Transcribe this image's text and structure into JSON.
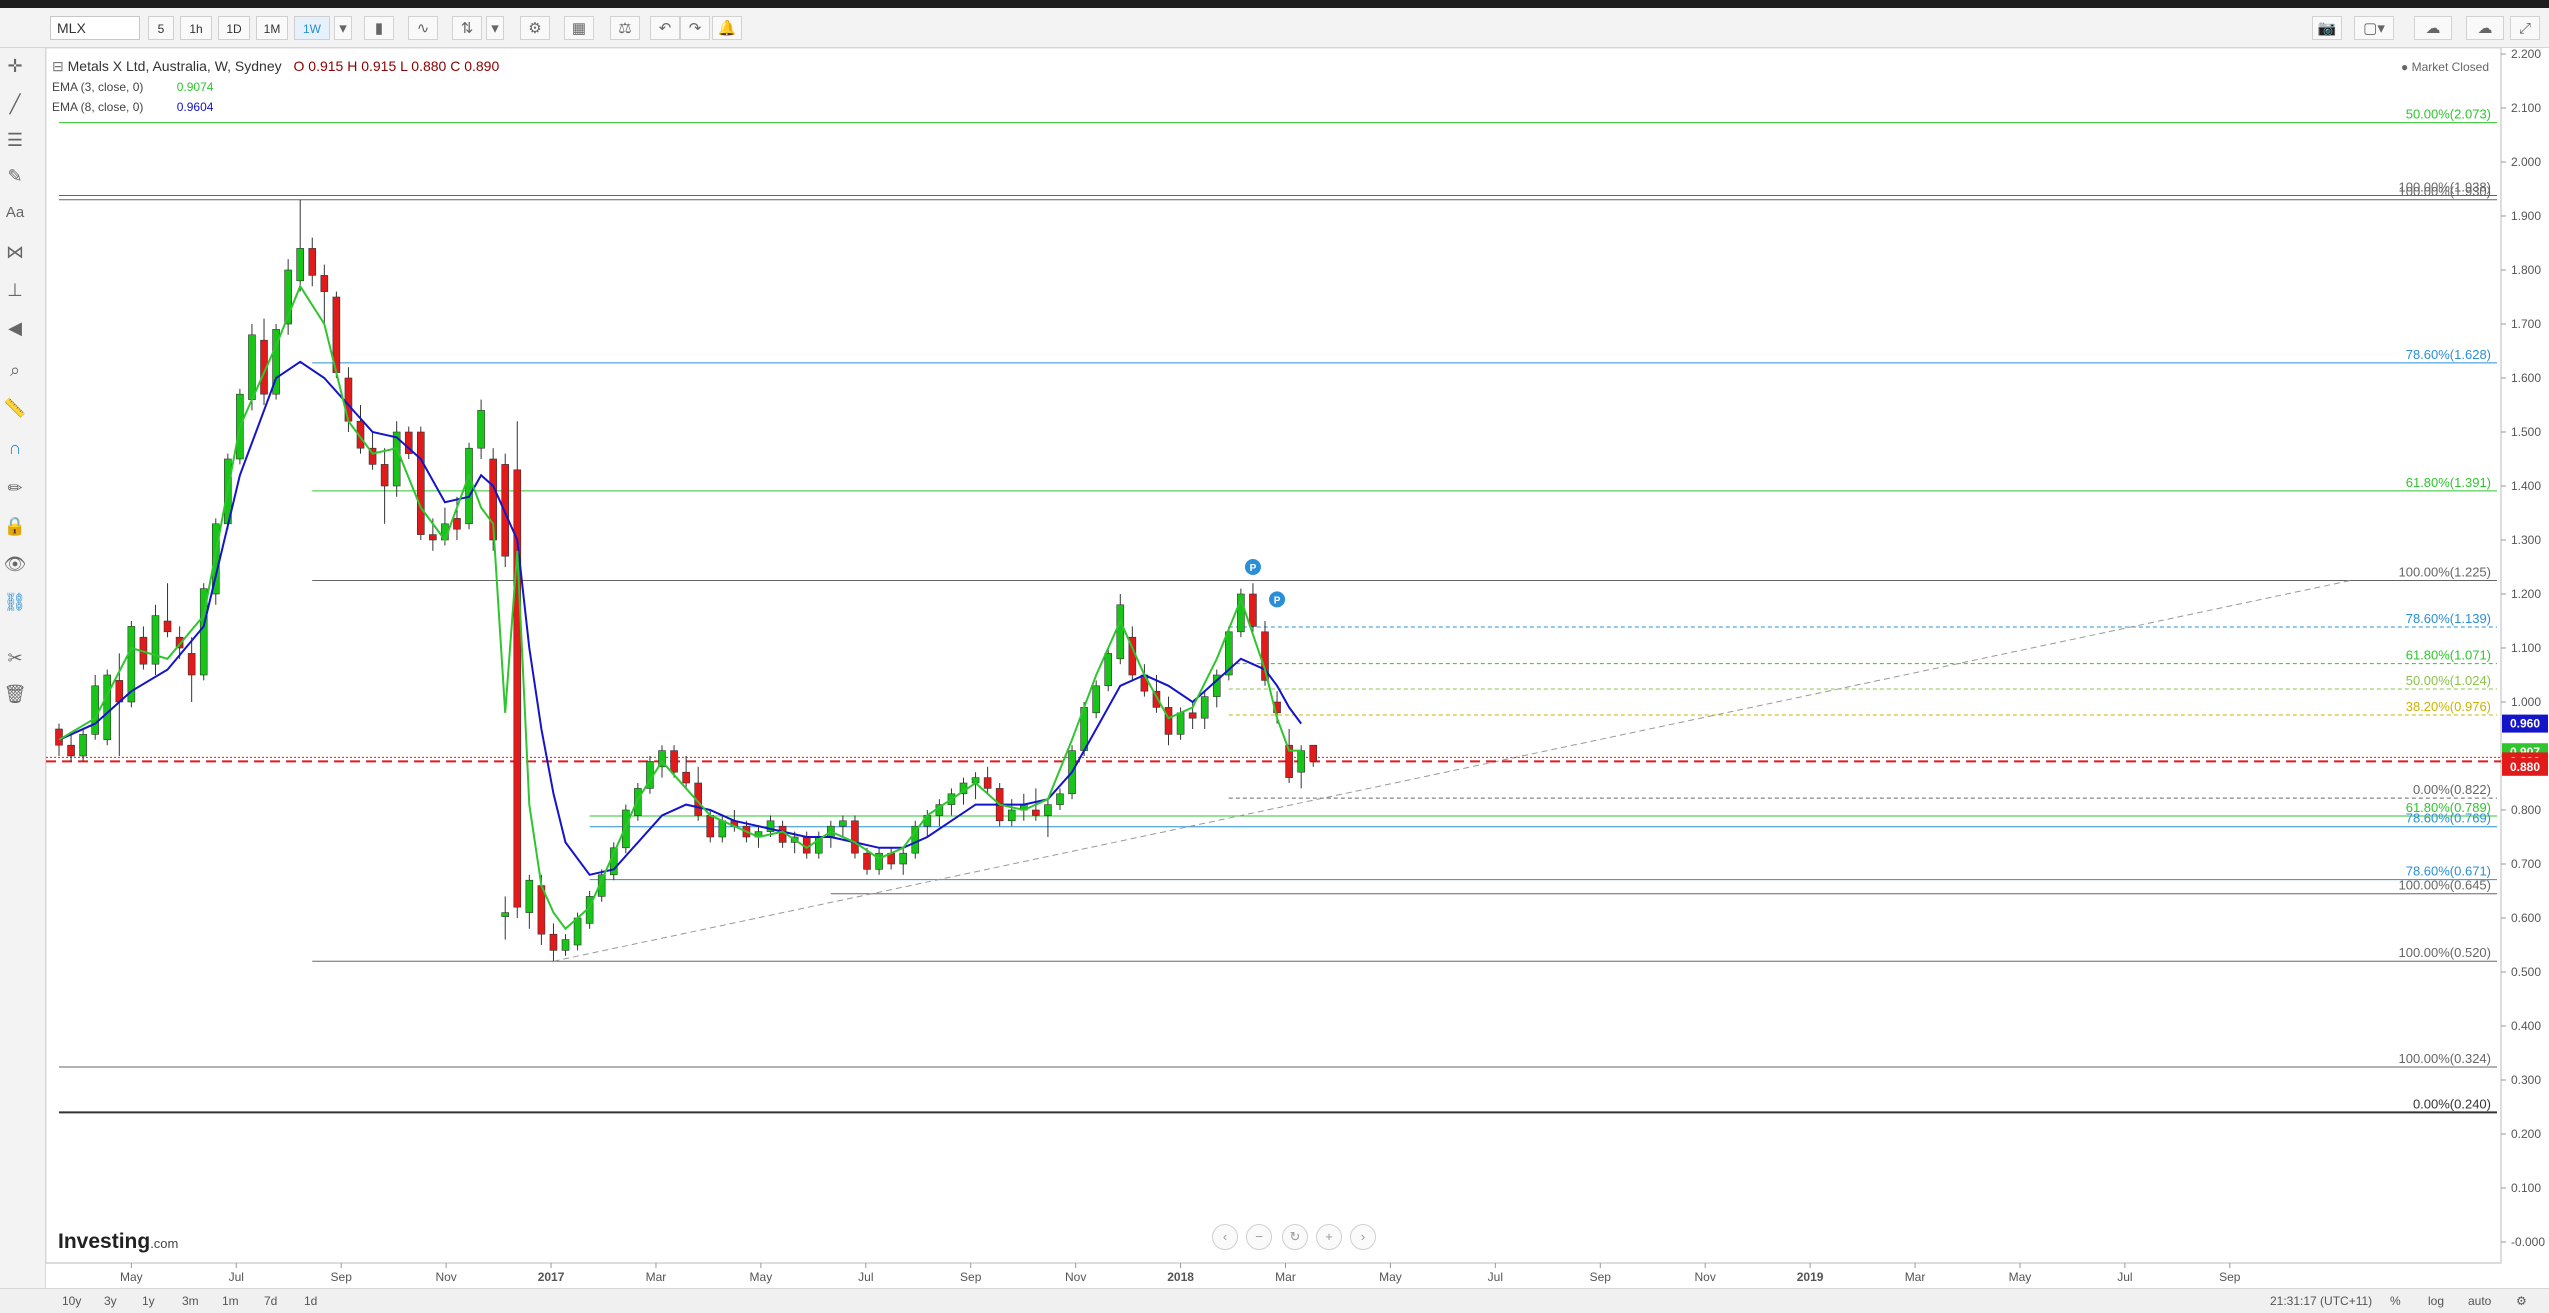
{
  "toolbar": {
    "symbol": "MLX",
    "timeframes": [
      "5",
      "1h",
      "1D",
      "1M",
      "1W"
    ],
    "active_timeframe": "1W"
  },
  "legend": {
    "title": "Metals X Ltd, Australia, W, Sydney",
    "ohlc": "O 0.915 H 0.915 L 0.880 C 0.890",
    "ema3_label": "EMA (3, close, 0)",
    "ema3_value": "0.9074",
    "ema8_label": "EMA (8, close, 0)",
    "ema8_value": "0.9604",
    "market_status": "Market Closed"
  },
  "bottom": {
    "ranges": [
      "10y",
      "3y",
      "1y",
      "3m",
      "1m",
      "7d",
      "1d"
    ],
    "time": "21:31:17 (UTC+11)",
    "options": [
      "%",
      "log",
      "auto"
    ]
  },
  "logo": {
    "brand": "Investing",
    "suffix": ".com"
  },
  "colors": {
    "up": "#19c519",
    "down": "#e11a1a",
    "ema3": "#2ec52e",
    "ema8": "#1414c8",
    "current_line": "#e11a1a"
  },
  "chart_data": {
    "type": "candlestick",
    "title": "Metals X Ltd, Australia, W, Sydney",
    "ylim": [
      -0.05,
      2.2
    ],
    "y_ticks": [
      "2.200",
      "2.100",
      "2.000",
      "1.900",
      "1.800",
      "1.700",
      "1.600",
      "1.500",
      "1.400",
      "1.300",
      "1.200",
      "1.100",
      "1.000",
      "0.900",
      "0.800",
      "0.700",
      "0.600",
      "0.500",
      "0.400",
      "0.300",
      "0.200",
      "0.100",
      "-0.000"
    ],
    "x_ticks": [
      "May",
      "Jul",
      "Sep",
      "Nov",
      "2017",
      "Mar",
      "May",
      "Jul",
      "Sep",
      "Nov",
      "2018",
      "Mar",
      "May",
      "Jul",
      "Sep",
      "Nov",
      "2019",
      "Mar",
      "May",
      "Jul",
      "Sep"
    ],
    "x_axis": {
      "first_tick_week": 6,
      "weeks_per_tick": 8.7
    },
    "price_labels": [
      {
        "text": "0.960",
        "value": 0.96,
        "color": "#1414c8"
      },
      {
        "text": "0.907",
        "value": 0.907,
        "color": "#2ec52e"
      },
      {
        "text": "0.890",
        "value": 0.89,
        "color": "#e11a1a"
      },
      {
        "text": "0.880",
        "value": 0.88,
        "color": "#e11a1a"
      }
    ],
    "current_price": 0.89,
    "candles": [
      [
        0.95,
        0.96,
        0.9,
        0.92
      ],
      [
        0.92,
        0.94,
        0.89,
        0.9
      ],
      [
        0.9,
        0.95,
        0.89,
        0.94
      ],
      [
        0.94,
        1.05,
        0.93,
        1.03
      ],
      [
        0.93,
        1.06,
        0.92,
        1.05
      ],
      [
        1.04,
        1.09,
        0.9,
        1.0
      ],
      [
        1.0,
        1.15,
        0.99,
        1.14
      ],
      [
        1.12,
        1.14,
        1.06,
        1.07
      ],
      [
        1.07,
        1.18,
        1.05,
        1.16
      ],
      [
        1.15,
        1.22,
        1.12,
        1.13
      ],
      [
        1.12,
        1.14,
        1.08,
        1.1
      ],
      [
        1.09,
        1.12,
        1.0,
        1.05
      ],
      [
        1.05,
        1.22,
        1.04,
        1.21
      ],
      [
        1.2,
        1.34,
        1.18,
        1.33
      ],
      [
        1.33,
        1.46,
        1.32,
        1.45
      ],
      [
        1.45,
        1.58,
        1.44,
        1.57
      ],
      [
        1.56,
        1.7,
        1.54,
        1.68
      ],
      [
        1.67,
        1.71,
        1.55,
        1.57
      ],
      [
        1.57,
        1.7,
        1.56,
        1.69
      ],
      [
        1.7,
        1.82,
        1.68,
        1.8
      ],
      [
        1.78,
        1.93,
        1.76,
        1.84
      ],
      [
        1.84,
        1.86,
        1.77,
        1.79
      ],
      [
        1.79,
        1.81,
        1.7,
        1.76
      ],
      [
        1.75,
        1.76,
        1.6,
        1.61
      ],
      [
        1.6,
        1.62,
        1.5,
        1.52
      ],
      [
        1.52,
        1.55,
        1.46,
        1.47
      ],
      [
        1.47,
        1.5,
        1.43,
        1.44
      ],
      [
        1.44,
        1.47,
        1.33,
        1.4
      ],
      [
        1.4,
        1.52,
        1.38,
        1.5
      ],
      [
        1.5,
        1.51,
        1.45,
        1.46
      ],
      [
        1.5,
        1.51,
        1.3,
        1.31
      ],
      [
        1.31,
        1.34,
        1.28,
        1.3
      ],
      [
        1.3,
        1.36,
        1.29,
        1.33
      ],
      [
        1.34,
        1.38,
        1.3,
        1.32
      ],
      [
        1.33,
        1.48,
        1.32,
        1.47
      ],
      [
        1.47,
        1.56,
        1.45,
        1.54
      ],
      [
        1.45,
        1.47,
        1.28,
        1.3
      ],
      [
        1.44,
        1.46,
        1.25,
        1.27
      ],
      [
        1.43,
        1.52,
        0.6,
        0.62
      ],
      [
        0.61,
        0.68,
        0.58,
        0.67
      ],
      [
        0.66,
        0.68,
        0.55,
        0.57
      ],
      [
        0.57,
        0.59,
        0.52,
        0.54
      ],
      [
        0.54,
        0.57,
        0.53,
        0.56
      ],
      [
        0.55,
        0.61,
        0.54,
        0.6
      ],
      [
        0.59,
        0.65,
        0.58,
        0.64
      ],
      [
        0.64,
        0.69,
        0.63,
        0.68
      ],
      [
        0.68,
        0.74,
        0.67,
        0.73
      ],
      [
        0.73,
        0.81,
        0.72,
        0.8
      ],
      [
        0.79,
        0.85,
        0.78,
        0.84
      ],
      [
        0.84,
        0.9,
        0.83,
        0.89
      ],
      [
        0.88,
        0.92,
        0.86,
        0.91
      ],
      [
        0.91,
        0.92,
        0.86,
        0.87
      ],
      [
        0.87,
        0.9,
        0.84,
        0.85
      ],
      [
        0.85,
        0.88,
        0.78,
        0.79
      ],
      [
        0.79,
        0.8,
        0.74,
        0.75
      ],
      [
        0.75,
        0.79,
        0.74,
        0.78
      ],
      [
        0.78,
        0.8,
        0.76,
        0.77
      ],
      [
        0.77,
        0.78,
        0.74,
        0.75
      ],
      [
        0.75,
        0.77,
        0.73,
        0.76
      ],
      [
        0.76,
        0.79,
        0.75,
        0.78
      ],
      [
        0.77,
        0.78,
        0.73,
        0.74
      ],
      [
        0.74,
        0.76,
        0.72,
        0.75
      ],
      [
        0.75,
        0.76,
        0.71,
        0.72
      ],
      [
        0.72,
        0.76,
        0.71,
        0.75
      ],
      [
        0.75,
        0.78,
        0.73,
        0.77
      ],
      [
        0.77,
        0.79,
        0.75,
        0.78
      ],
      [
        0.78,
        0.79,
        0.71,
        0.72
      ],
      [
        0.72,
        0.73,
        0.68,
        0.69
      ],
      [
        0.69,
        0.73,
        0.68,
        0.72
      ],
      [
        0.72,
        0.73,
        0.69,
        0.7
      ],
      [
        0.7,
        0.73,
        0.68,
        0.72
      ],
      [
        0.72,
        0.78,
        0.71,
        0.77
      ],
      [
        0.77,
        0.8,
        0.75,
        0.79
      ],
      [
        0.79,
        0.82,
        0.77,
        0.81
      ],
      [
        0.81,
        0.84,
        0.79,
        0.83
      ],
      [
        0.83,
        0.86,
        0.81,
        0.85
      ],
      [
        0.85,
        0.87,
        0.82,
        0.86
      ],
      [
        0.86,
        0.88,
        0.83,
        0.84
      ],
      [
        0.84,
        0.85,
        0.77,
        0.78
      ],
      [
        0.78,
        0.82,
        0.77,
        0.8
      ],
      [
        0.8,
        0.83,
        0.78,
        0.81
      ],
      [
        0.8,
        0.84,
        0.78,
        0.79
      ],
      [
        0.79,
        0.82,
        0.75,
        0.81
      ],
      [
        0.81,
        0.84,
        0.8,
        0.83
      ],
      [
        0.83,
        0.92,
        0.82,
        0.91
      ],
      [
        0.91,
        1.0,
        0.9,
        0.99
      ],
      [
        0.98,
        1.04,
        0.97,
        1.03
      ],
      [
        1.03,
        1.1,
        1.02,
        1.09
      ],
      [
        1.08,
        1.2,
        1.07,
        1.18
      ],
      [
        1.12,
        1.14,
        1.04,
        1.05
      ],
      [
        1.05,
        1.07,
        1.01,
        1.02
      ],
      [
        1.02,
        1.05,
        0.98,
        0.99
      ],
      [
        0.99,
        1.01,
        0.92,
        0.94
      ],
      [
        0.94,
        0.99,
        0.93,
        0.98
      ],
      [
        0.98,
        1.0,
        0.95,
        0.97
      ],
      [
        0.97,
        1.02,
        0.95,
        1.01
      ],
      [
        1.01,
        1.06,
        0.99,
        1.05
      ],
      [
        1.05,
        1.14,
        1.04,
        1.13
      ],
      [
        1.13,
        1.21,
        1.12,
        1.2
      ],
      [
        1.2,
        1.22,
        1.13,
        1.14
      ],
      [
        1.13,
        1.15,
        1.03,
        1.04
      ],
      [
        1.0,
        1.02,
        0.96,
        0.98
      ],
      [
        0.92,
        0.95,
        0.85,
        0.86
      ],
      [
        0.87,
        0.92,
        0.84,
        0.91
      ],
      [
        0.92,
        0.92,
        0.88,
        0.89
      ]
    ],
    "ema3": [
      [
        0,
        0.93
      ],
      [
        3,
        0.97
      ],
      [
        6,
        1.1
      ],
      [
        9,
        1.08
      ],
      [
        12,
        1.16
      ],
      [
        15,
        1.51
      ],
      [
        18,
        1.66
      ],
      [
        20,
        1.77
      ],
      [
        22,
        1.7
      ],
      [
        24,
        1.52
      ],
      [
        26,
        1.46
      ],
      [
        28,
        1.47
      ],
      [
        30,
        1.36
      ],
      [
        32,
        1.3
      ],
      [
        34,
        1.42
      ],
      [
        35,
        1.36
      ],
      [
        36,
        1.33
      ],
      [
        37,
        0.98
      ],
      [
        38,
        1.28
      ],
      [
        39,
        0.81
      ],
      [
        40,
        0.66
      ],
      [
        41,
        0.61
      ],
      [
        42,
        0.58
      ],
      [
        44,
        0.62
      ],
      [
        46,
        0.72
      ],
      [
        48,
        0.82
      ],
      [
        50,
        0.89
      ],
      [
        52,
        0.84
      ],
      [
        54,
        0.79
      ],
      [
        56,
        0.77
      ],
      [
        58,
        0.75
      ],
      [
        60,
        0.76
      ],
      [
        62,
        0.73
      ],
      [
        64,
        0.76
      ],
      [
        66,
        0.74
      ],
      [
        68,
        0.71
      ],
      [
        70,
        0.73
      ],
      [
        72,
        0.79
      ],
      [
        74,
        0.82
      ],
      [
        76,
        0.85
      ],
      [
        78,
        0.81
      ],
      [
        80,
        0.8
      ],
      [
        82,
        0.82
      ],
      [
        84,
        0.93
      ],
      [
        86,
        1.05
      ],
      [
        88,
        1.15
      ],
      [
        90,
        1.05
      ],
      [
        92,
        0.97
      ],
      [
        94,
        0.99
      ],
      [
        96,
        1.08
      ],
      [
        98,
        1.19
      ],
      [
        100,
        1.06
      ],
      [
        101,
        0.97
      ],
      [
        102,
        0.91
      ],
      [
        103,
        0.91
      ]
    ],
    "ema8": [
      [
        0,
        0.93
      ],
      [
        3,
        0.96
      ],
      [
        6,
        1.02
      ],
      [
        9,
        1.06
      ],
      [
        12,
        1.14
      ],
      [
        15,
        1.42
      ],
      [
        18,
        1.6
      ],
      [
        20,
        1.63
      ],
      [
        22,
        1.6
      ],
      [
        24,
        1.55
      ],
      [
        26,
        1.5
      ],
      [
        28,
        1.49
      ],
      [
        30,
        1.45
      ],
      [
        32,
        1.37
      ],
      [
        34,
        1.38
      ],
      [
        35,
        1.42
      ],
      [
        36,
        1.4
      ],
      [
        38,
        1.3
      ],
      [
        39,
        1.1
      ],
      [
        40,
        0.95
      ],
      [
        41,
        0.83
      ],
      [
        42,
        0.74
      ],
      [
        44,
        0.68
      ],
      [
        46,
        0.69
      ],
      [
        48,
        0.74
      ],
      [
        50,
        0.79
      ],
      [
        52,
        0.81
      ],
      [
        54,
        0.8
      ],
      [
        56,
        0.78
      ],
      [
        58,
        0.77
      ],
      [
        60,
        0.76
      ],
      [
        62,
        0.75
      ],
      [
        64,
        0.75
      ],
      [
        66,
        0.74
      ],
      [
        68,
        0.73
      ],
      [
        70,
        0.73
      ],
      [
        72,
        0.75
      ],
      [
        74,
        0.78
      ],
      [
        76,
        0.81
      ],
      [
        78,
        0.81
      ],
      [
        80,
        0.81
      ],
      [
        82,
        0.82
      ],
      [
        84,
        0.87
      ],
      [
        86,
        0.95
      ],
      [
        88,
        1.03
      ],
      [
        90,
        1.05
      ],
      [
        92,
        1.03
      ],
      [
        94,
        1.0
      ],
      [
        96,
        1.04
      ],
      [
        98,
        1.08
      ],
      [
        100,
        1.06
      ],
      [
        101,
        1.03
      ],
      [
        102,
        0.99
      ],
      [
        103,
        0.96
      ]
    ],
    "fib_lines": [
      {
        "value": 2.073,
        "label": "50.00%(2.073)",
        "color": "#2ec52e",
        "from": 0,
        "style": "solid"
      },
      {
        "value": 1.938,
        "label": "100.00%(1.938)",
        "color": "#666666",
        "from": 0,
        "style": "solid"
      },
      {
        "value": 1.93,
        "label": "100.00%(1.930)",
        "color": "#666666",
        "from": 0,
        "style": "solid"
      },
      {
        "value": 1.628,
        "label": "78.60%(1.628)",
        "color": "#2a8fd6",
        "from": 21,
        "style": "solid"
      },
      {
        "value": 1.391,
        "label": "61.80%(1.391)",
        "color": "#2ec52e",
        "from": 21,
        "style": "solid"
      },
      {
        "value": 1.225,
        "label": "100.00%(1.225)",
        "color": "#666666",
        "from": 21,
        "style": "solid"
      },
      {
        "value": 1.139,
        "label": "78.60%(1.139)",
        "color": "#2a8fd6",
        "from": 97,
        "style": "dashed"
      },
      {
        "value": 1.071,
        "label": "61.80%(1.071)",
        "color": "#2ec52e",
        "from": 97,
        "style": "dashed"
      },
      {
        "value": 1.024,
        "label": "50.00%(1.024)",
        "color": "#8bc34a",
        "from": 97,
        "style": "dashed"
      },
      {
        "value": 0.976,
        "label": "38.20%(0.976)",
        "color": "#c8b400",
        "from": 97,
        "style": "dashed"
      },
      {
        "value": 0.822,
        "label": "0.00%(0.822)",
        "color": "#666666",
        "from": 97,
        "style": "dashed"
      },
      {
        "value": 0.789,
        "label": "61.80%(0.789)",
        "color": "#2ec52e",
        "from": 44,
        "style": "solid"
      },
      {
        "value": 0.769,
        "label": "78.60%(0.769)",
        "color": "#2a8fd6",
        "from": 44,
        "style": "solid"
      },
      {
        "value": 0.671,
        "label": "78.60%(0.671)",
        "color": "#2a8fd6",
        "from": 44,
        "style": "solid"
      },
      {
        "value": 0.645,
        "label": "100.00%(0.645)",
        "color": "#666666",
        "from": 64,
        "style": "solid"
      },
      {
        "value": 0.52,
        "label": "100.00%(0.520)",
        "color": "#666666",
        "from": 21,
        "style": "solid"
      },
      {
        "value": 0.324,
        "label": "100.00%(0.324)",
        "color": "#666666",
        "from": 0,
        "style": "solid"
      },
      {
        "value": 0.24,
        "label": "0.00%(0.240)",
        "color": "#333333",
        "from": 0,
        "style": "solid"
      }
    ],
    "trendline": {
      "from": [
        41,
        0.52
      ],
      "to": [
        190,
        1.225
      ]
    },
    "markers": [
      {
        "index": 99,
        "value": 1.25,
        "text": "P"
      },
      {
        "index": 101,
        "value": 1.19,
        "text": "P"
      }
    ],
    "isolated_candle": {
      "index": 37,
      "value": 0.6
    }
  }
}
